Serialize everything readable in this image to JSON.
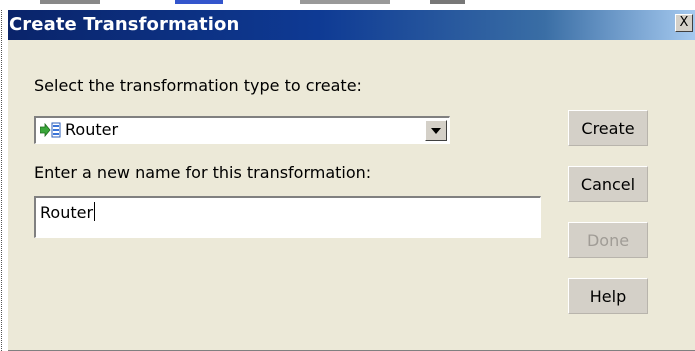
{
  "dialog": {
    "title": "Create Transformation",
    "close_label": "X"
  },
  "form": {
    "type_label": "Select the transformation type to create:",
    "type_value": "Router",
    "type_icon": "router-transformation-icon",
    "name_label": "Enter a new name for this transformation:",
    "name_value": "Router"
  },
  "buttons": {
    "create": "Create",
    "cancel": "Cancel",
    "done": "Done",
    "help": "Help"
  },
  "colors": {
    "dialog_bg": "#ece9d8",
    "titlebar_start": "#0a246a",
    "titlebar_end": "#a6caf0",
    "disabled_text": "#a09c96"
  }
}
